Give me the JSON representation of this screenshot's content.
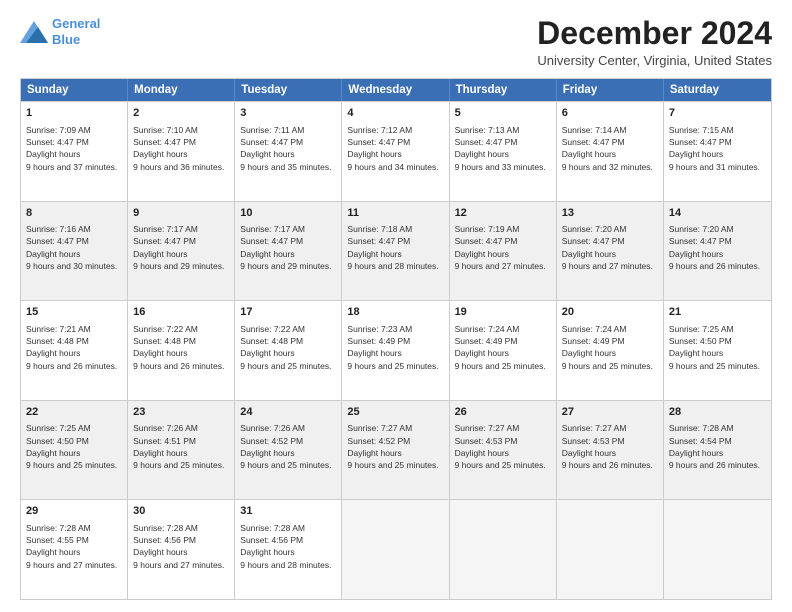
{
  "logo": {
    "line1": "General",
    "line2": "Blue"
  },
  "title": "December 2024",
  "subtitle": "University Center, Virginia, United States",
  "header_days": [
    "Sunday",
    "Monday",
    "Tuesday",
    "Wednesday",
    "Thursday",
    "Friday",
    "Saturday"
  ],
  "weeks": [
    [
      {
        "day": "1",
        "sunrise": "7:09 AM",
        "sunset": "4:47 PM",
        "daylight": "9 hours and 37 minutes."
      },
      {
        "day": "2",
        "sunrise": "7:10 AM",
        "sunset": "4:47 PM",
        "daylight": "9 hours and 36 minutes."
      },
      {
        "day": "3",
        "sunrise": "7:11 AM",
        "sunset": "4:47 PM",
        "daylight": "9 hours and 35 minutes."
      },
      {
        "day": "4",
        "sunrise": "7:12 AM",
        "sunset": "4:47 PM",
        "daylight": "9 hours and 34 minutes."
      },
      {
        "day": "5",
        "sunrise": "7:13 AM",
        "sunset": "4:47 PM",
        "daylight": "9 hours and 33 minutes."
      },
      {
        "day": "6",
        "sunrise": "7:14 AM",
        "sunset": "4:47 PM",
        "daylight": "9 hours and 32 minutes."
      },
      {
        "day": "7",
        "sunrise": "7:15 AM",
        "sunset": "4:47 PM",
        "daylight": "9 hours and 31 minutes."
      }
    ],
    [
      {
        "day": "8",
        "sunrise": "7:16 AM",
        "sunset": "4:47 PM",
        "daylight": "9 hours and 30 minutes."
      },
      {
        "day": "9",
        "sunrise": "7:17 AM",
        "sunset": "4:47 PM",
        "daylight": "9 hours and 29 minutes."
      },
      {
        "day": "10",
        "sunrise": "7:17 AM",
        "sunset": "4:47 PM",
        "daylight": "9 hours and 29 minutes."
      },
      {
        "day": "11",
        "sunrise": "7:18 AM",
        "sunset": "4:47 PM",
        "daylight": "9 hours and 28 minutes."
      },
      {
        "day": "12",
        "sunrise": "7:19 AM",
        "sunset": "4:47 PM",
        "daylight": "9 hours and 27 minutes."
      },
      {
        "day": "13",
        "sunrise": "7:20 AM",
        "sunset": "4:47 PM",
        "daylight": "9 hours and 27 minutes."
      },
      {
        "day": "14",
        "sunrise": "7:20 AM",
        "sunset": "4:47 PM",
        "daylight": "9 hours and 26 minutes."
      }
    ],
    [
      {
        "day": "15",
        "sunrise": "7:21 AM",
        "sunset": "4:48 PM",
        "daylight": "9 hours and 26 minutes."
      },
      {
        "day": "16",
        "sunrise": "7:22 AM",
        "sunset": "4:48 PM",
        "daylight": "9 hours and 26 minutes."
      },
      {
        "day": "17",
        "sunrise": "7:22 AM",
        "sunset": "4:48 PM",
        "daylight": "9 hours and 25 minutes."
      },
      {
        "day": "18",
        "sunrise": "7:23 AM",
        "sunset": "4:49 PM",
        "daylight": "9 hours and 25 minutes."
      },
      {
        "day": "19",
        "sunrise": "7:24 AM",
        "sunset": "4:49 PM",
        "daylight": "9 hours and 25 minutes."
      },
      {
        "day": "20",
        "sunrise": "7:24 AM",
        "sunset": "4:49 PM",
        "daylight": "9 hours and 25 minutes."
      },
      {
        "day": "21",
        "sunrise": "7:25 AM",
        "sunset": "4:50 PM",
        "daylight": "9 hours and 25 minutes."
      }
    ],
    [
      {
        "day": "22",
        "sunrise": "7:25 AM",
        "sunset": "4:50 PM",
        "daylight": "9 hours and 25 minutes."
      },
      {
        "day": "23",
        "sunrise": "7:26 AM",
        "sunset": "4:51 PM",
        "daylight": "9 hours and 25 minutes."
      },
      {
        "day": "24",
        "sunrise": "7:26 AM",
        "sunset": "4:52 PM",
        "daylight": "9 hours and 25 minutes."
      },
      {
        "day": "25",
        "sunrise": "7:27 AM",
        "sunset": "4:52 PM",
        "daylight": "9 hours and 25 minutes."
      },
      {
        "day": "26",
        "sunrise": "7:27 AM",
        "sunset": "4:53 PM",
        "daylight": "9 hours and 25 minutes."
      },
      {
        "day": "27",
        "sunrise": "7:27 AM",
        "sunset": "4:53 PM",
        "daylight": "9 hours and 26 minutes."
      },
      {
        "day": "28",
        "sunrise": "7:28 AM",
        "sunset": "4:54 PM",
        "daylight": "9 hours and 26 minutes."
      }
    ],
    [
      {
        "day": "29",
        "sunrise": "7:28 AM",
        "sunset": "4:55 PM",
        "daylight": "9 hours and 27 minutes."
      },
      {
        "day": "30",
        "sunrise": "7:28 AM",
        "sunset": "4:56 PM",
        "daylight": "9 hours and 27 minutes."
      },
      {
        "day": "31",
        "sunrise": "7:28 AM",
        "sunset": "4:56 PM",
        "daylight": "9 hours and 28 minutes."
      },
      null,
      null,
      null,
      null
    ]
  ]
}
